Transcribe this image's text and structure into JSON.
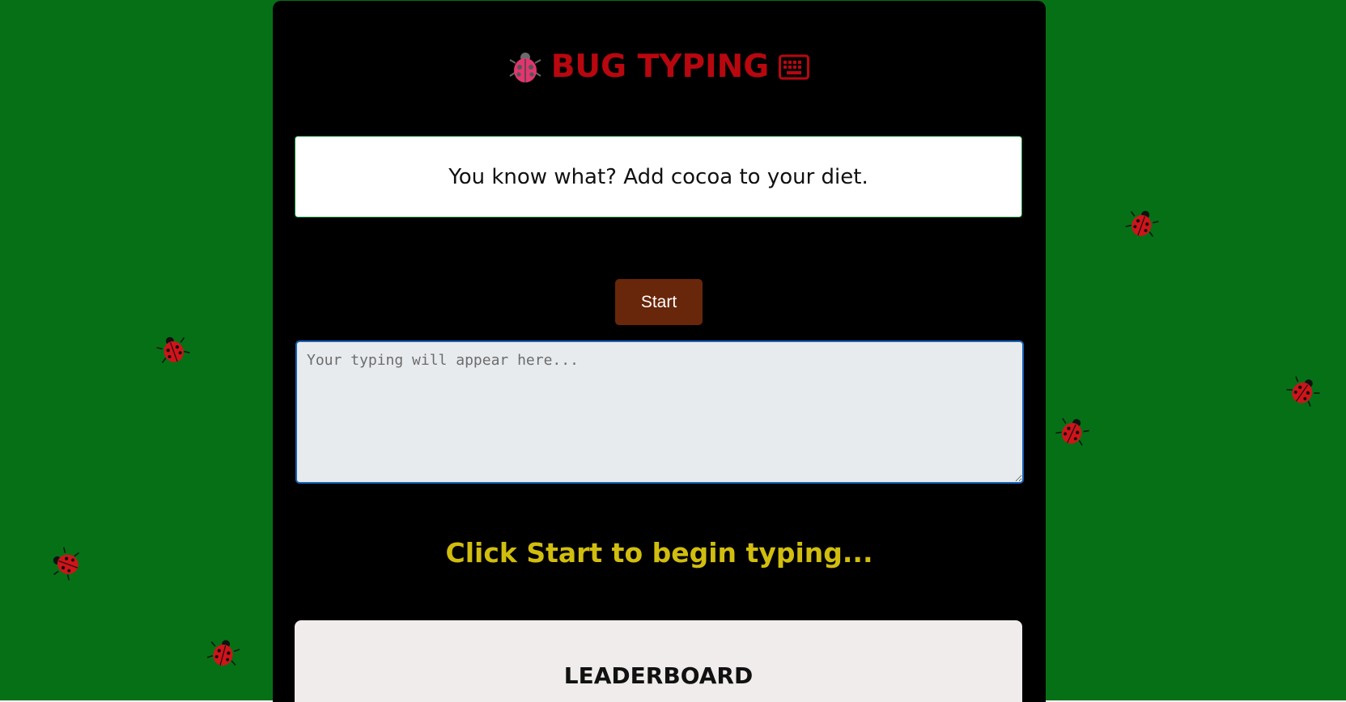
{
  "app": {
    "title": "BUG TYPING",
    "title_icon_left": "ladybug-icon",
    "title_icon_right": "keyboard-icon"
  },
  "quote": {
    "text": "You know what? Add cocoa to your diet."
  },
  "controls": {
    "start_label": "Start"
  },
  "typing": {
    "value": "",
    "placeholder": "Your typing will appear here..."
  },
  "status": {
    "message": "Click Start to begin typing..."
  },
  "leaderboard": {
    "title": "LEADERBOARD"
  },
  "colors": {
    "background": "#067016",
    "panel": "#000000",
    "title": "#b8070f",
    "start_button": "#68260a",
    "status": "#d1bd0e",
    "leaderboard_bg": "#f0eceb"
  },
  "decorations": {
    "ladybug_icon": "ladybug-icon",
    "count": 7
  }
}
